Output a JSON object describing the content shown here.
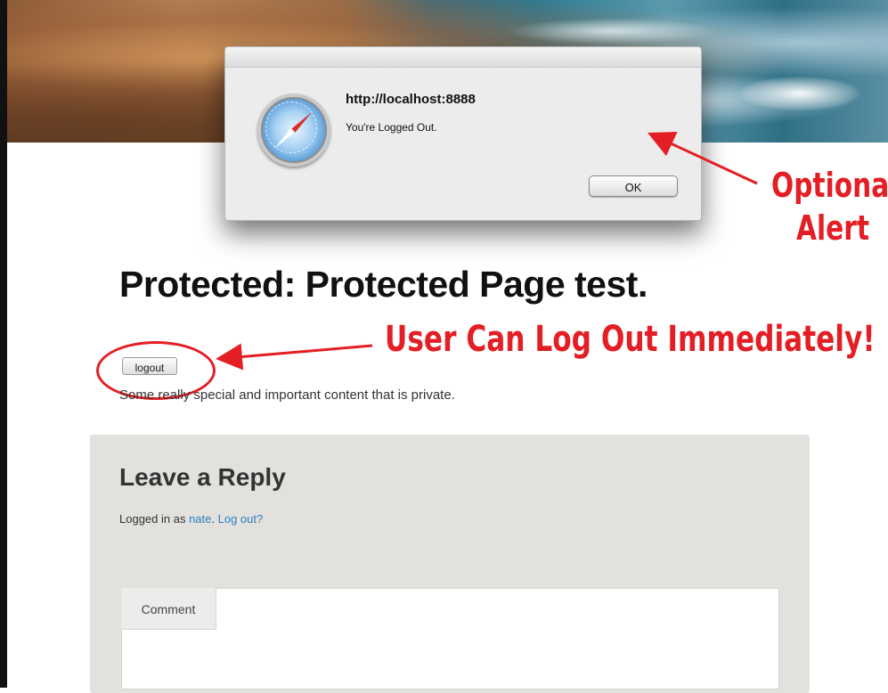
{
  "dialog": {
    "title": "http://localhost:8888",
    "message": "You're Logged Out.",
    "ok_label": "OK"
  },
  "annotations": {
    "optional_line1": "Optional",
    "optional_line2": "Alert",
    "logout_callout": "User Can Log Out Immediately!"
  },
  "page": {
    "title": "Protected: Protected Page test.",
    "logout_label": "logout",
    "content": "Some really special and important content that is private."
  },
  "reply": {
    "title": "Leave a Reply",
    "logged_in_prefix": "Logged in as ",
    "user": "nate",
    "separator": ". ",
    "logout_link": "Log out?",
    "comment_tab": "Comment"
  },
  "colors": {
    "annotation": "#e31e24",
    "link": "#2b7fc2",
    "reply_bg": "#e2e1dd"
  }
}
